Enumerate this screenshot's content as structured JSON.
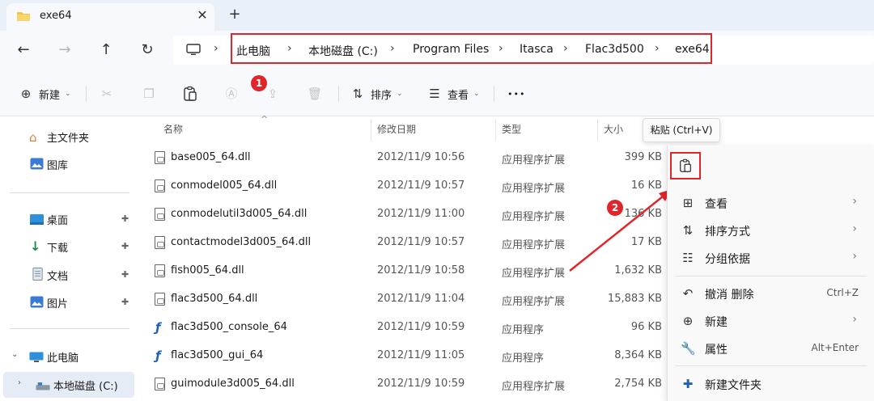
{
  "tab": {
    "title": "exe64",
    "close_glyph": "✕",
    "new_tab_glyph": "+"
  },
  "nav": {
    "back": "←",
    "forward": "→",
    "up": "↑",
    "refresh": "↻",
    "sep": "›"
  },
  "breadcrumb": [
    "此电脑",
    "本地磁盘 (C:)",
    "Program Files",
    "Itasca",
    "Flac3d500",
    "exe64"
  ],
  "toolbar": {
    "new_label": "新建",
    "sort_label": "排序",
    "view_label": "查看",
    "more_label": "•••",
    "badge1": "1",
    "icons": [
      "new-icon",
      "cut-icon",
      "copy-icon",
      "paste-icon",
      "rename-icon",
      "share-icon",
      "delete-icon",
      "sort-icon",
      "view-icon",
      "more-icon"
    ]
  },
  "sidebar": {
    "top": [
      {
        "label": "主文件夹",
        "icon": "home-icon"
      },
      {
        "label": "图库",
        "icon": "gallery-icon"
      }
    ],
    "pinned": [
      {
        "label": "桌面",
        "icon": "desktop-icon"
      },
      {
        "label": "下载",
        "icon": "download-icon"
      },
      {
        "label": "文档",
        "icon": "documents-icon"
      },
      {
        "label": "图片",
        "icon": "pictures-icon"
      }
    ],
    "pin_glyph": "📌",
    "tree": [
      {
        "label": "此电脑",
        "icon": "pc-icon",
        "chevron": "⌄"
      },
      {
        "label": "本地磁盘 (C:)",
        "icon": "drive-icon",
        "chevron": "›"
      }
    ]
  },
  "columns": {
    "name": "名称",
    "date": "修改日期",
    "type": "类型",
    "size": "大小",
    "sort_glyph": "^"
  },
  "files": [
    {
      "name": "base005_64.dll",
      "date": "2012/11/9 10:56",
      "type": "应用程序扩展",
      "size": "399 KB",
      "kind": "dll"
    },
    {
      "name": "conmodel005_64.dll",
      "date": "2012/11/9 10:57",
      "type": "应用程序扩展",
      "size": "16 KB",
      "kind": "dll"
    },
    {
      "name": "conmodelutil3d005_64.dll",
      "date": "2012/11/9 11:00",
      "type": "应用程序扩展",
      "size": "136 KB",
      "kind": "dll"
    },
    {
      "name": "contactmodel3d005_64.dll",
      "date": "2012/11/9 10:57",
      "type": "应用程序扩展",
      "size": "17 KB",
      "kind": "dll"
    },
    {
      "name": "fish005_64.dll",
      "date": "2012/11/9 10:58",
      "type": "应用程序扩展",
      "size": "1,632 KB",
      "kind": "dll"
    },
    {
      "name": "flac3d500_64.dll",
      "date": "2012/11/9 11:04",
      "type": "应用程序扩展",
      "size": "15,883 KB",
      "kind": "dll"
    },
    {
      "name": "flac3d500_console_64",
      "date": "2012/11/9 10:59",
      "type": "应用程序",
      "size": "96 KB",
      "kind": "exe"
    },
    {
      "name": "flac3d500_gui_64",
      "date": "2012/11/9 11:05",
      "type": "应用程序",
      "size": "8,364 KB",
      "kind": "exe"
    },
    {
      "name": "guimodule3d005_64.dll",
      "date": "2012/11/9 10:59",
      "type": "应用程序扩展",
      "size": "2,754 KB",
      "kind": "dll"
    }
  ],
  "tooltip": {
    "text": "粘贴 (Ctrl+V)"
  },
  "context_menu": {
    "badge2": "2",
    "items": [
      {
        "label": "查看",
        "icon": "grid-icon",
        "arrow": "›"
      },
      {
        "label": "排序方式",
        "icon": "sort-icon",
        "arrow": "›"
      },
      {
        "label": "分组依据",
        "icon": "group-icon",
        "arrow": "›"
      },
      {
        "label": "撤消 删除",
        "icon": "undo-icon",
        "shortcut": "Ctrl+Z"
      },
      {
        "label": "新建",
        "icon": "new-icon",
        "arrow": "›"
      },
      {
        "label": "属性",
        "icon": "wrench-icon",
        "shortcut": "Alt+Enter"
      },
      {
        "label": "新建文件夹",
        "icon": "new-folder-icon"
      }
    ]
  },
  "colors": {
    "accent_red": "#e0262b",
    "folder_yellow": "#f4c542",
    "chrome_bg": "#eaf0f7",
    "toolbar_bg": "#f7f9fc"
  }
}
